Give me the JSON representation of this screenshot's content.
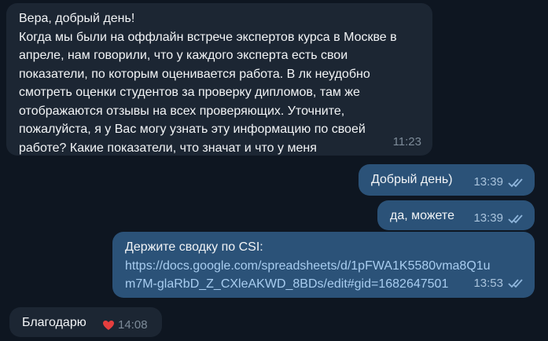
{
  "messages": [
    {
      "direction": "incoming",
      "lines": [
        "Вера, добрый день!",
        "Когда мы были на оффлайн встрече экспертов курса в Москве в",
        "апреле, нам говорили, что у каждого эксперта есть свои",
        "показатели, по которым оценивается работа. В лк неудобно",
        "смотреть оценки студентов за проверку дипломов, там же",
        "отображаются отзывы на всех проверяющих. Уточните,",
        "пожалуйста, я у Вас могу узнать эту информацию по своей",
        "работе? Какие показатели, что значат и что у меня"
      ],
      "time": "11:23"
    },
    {
      "direction": "outgoing",
      "text": "Добрый день)",
      "time": "13:39",
      "status": "read"
    },
    {
      "direction": "outgoing",
      "text": "да, можете",
      "time": "13:39",
      "status": "read"
    },
    {
      "direction": "outgoing",
      "text": "Держите сводку по CSI:",
      "link_lines": [
        "https://docs.google.com/spreadsheets/d/1pFWA1K5580vma8Q1u",
        "m7M-glaRbD_Z_CXleAKWD_8BDs/edit#gid=1682647501"
      ],
      "time": "13:53",
      "status": "read"
    },
    {
      "direction": "incoming",
      "text": "Благодарю",
      "reaction": "heart-icon",
      "time": "14:08"
    }
  ],
  "colors": {
    "background": "#0e1621",
    "incoming_bubble": "#1c2633",
    "outgoing_bubble": "#2b5278",
    "link": "#a8cdf0",
    "reaction": "#e53e3e"
  }
}
